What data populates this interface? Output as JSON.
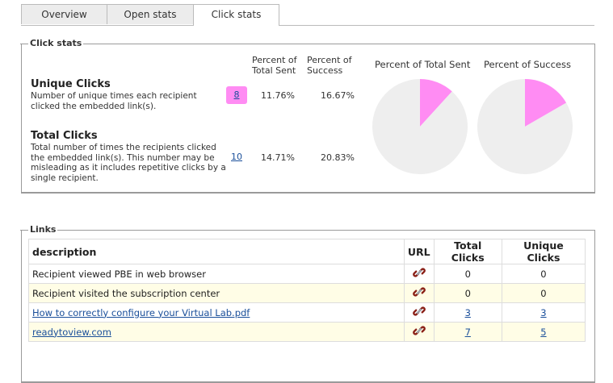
{
  "tabs": [
    {
      "label": "Overview"
    },
    {
      "label": "Open stats"
    },
    {
      "label": "Click stats"
    }
  ],
  "click_stats": {
    "legend": "Click stats",
    "col_percent_total_sent": "Percent of Total Sent",
    "col_percent_success": "Percent of Success",
    "unique": {
      "title": "Unique Clicks",
      "desc": "Number of unique times each recipient clicked the embedded link(s).",
      "count": "8",
      "pct_total_sent": "11.76%",
      "pct_success": "16.67%"
    },
    "total": {
      "title": "Total Clicks",
      "desc": "Total number of times the recipients clicked the embedded link(s). This number may be misleading as it includes repetitive clicks by a single recipient.",
      "count": "10",
      "pct_total_sent": "14.71%",
      "pct_success": "20.83%"
    },
    "chart_titles": [
      "Percent of Total Sent",
      "Percent of Success"
    ]
  },
  "chart_data": [
    {
      "type": "pie",
      "title": "Percent of Total Sent",
      "values": [
        11.76,
        88.24
      ],
      "colors": [
        "#ff8cf3",
        "#eeeeee"
      ]
    },
    {
      "type": "pie",
      "title": "Percent of Success",
      "values": [
        16.67,
        83.33
      ],
      "colors": [
        "#ff8cf3",
        "#eeeeee"
      ]
    }
  ],
  "links": {
    "legend": "Links",
    "headers": {
      "description": "description",
      "url": "URL",
      "total": "Total Clicks",
      "unique": "Unique Clicks"
    },
    "rows": [
      {
        "description": "Recipient viewed PBE in web browser",
        "is_link": false,
        "total": "0",
        "unique": "0"
      },
      {
        "description": "Recipient visited the subscription center",
        "is_link": false,
        "total": "0",
        "unique": "0"
      },
      {
        "description": "How to correctly configure your Virtual Lab.pdf",
        "is_link": true,
        "total": "3",
        "unique": "3"
      },
      {
        "description": "readytoview.com",
        "is_link": true,
        "total": "7",
        "unique": "5"
      }
    ]
  },
  "icons": {
    "url": "chain-link-icon"
  },
  "colors": {
    "accent_pink": "#ff8cf3",
    "pie_bg": "#eeeeee",
    "row_alt": "#fffde6",
    "link": "#1a4f9a"
  }
}
